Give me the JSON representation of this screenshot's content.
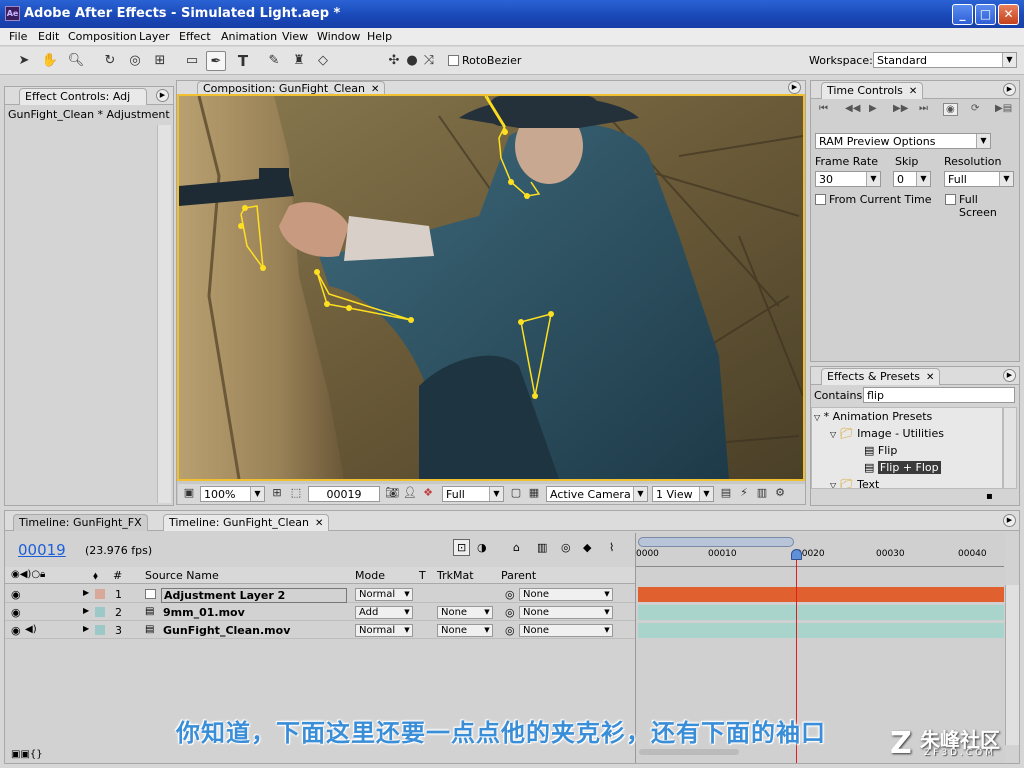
{
  "window": {
    "title": "Adobe After Effects - Simulated Light.aep *",
    "app_icon": "Ae"
  },
  "menu": [
    "File",
    "Edit",
    "Composition",
    "Layer",
    "Effect",
    "Animation",
    "View",
    "Window",
    "Help"
  ],
  "toolbar": {
    "rotobezier_label": "RotoBezier",
    "workspace_label": "Workspace:",
    "workspace_value": "Standard"
  },
  "effect_controls": {
    "tab_label": "Effect Controls: Adj",
    "layer_label": "GunFight_Clean * Adjustment Lay"
  },
  "composition": {
    "tab_label": "Composition: GunFight_Clean",
    "zoom": "100%",
    "timecode": "00019",
    "resolution": "Full",
    "camera": "Active Camera",
    "view": "1 View"
  },
  "time_controls": {
    "tab_label": "Time Controls",
    "ram_preview": "RAM Preview Options",
    "frame_rate_label": "Frame Rate",
    "frame_rate": "30",
    "skip_label": "Skip",
    "skip": "0",
    "resolution_label": "Resolution",
    "resolution": "Full",
    "from_current": "From Current Time",
    "full_screen": "Full Screen"
  },
  "effects_presets": {
    "tab_label": "Effects & Presets",
    "contains_label": "Contains:",
    "contains_value": "flip",
    "tree": [
      "* Animation Presets",
      "Image - Utilities",
      "Flip",
      "Flip + Flop",
      "Text"
    ]
  },
  "timeline": {
    "tabs": [
      "Timeline: GunFight_FX",
      "Timeline: GunFight_Clean"
    ],
    "timecode": "00019",
    "fps": "(23.976 fps)",
    "headers": {
      "num": "#",
      "source": "Source Name",
      "mode": "Mode",
      "t": "T",
      "trkmat": "TrkMat",
      "parent": "Parent"
    },
    "ruler": [
      "0000",
      "00010",
      "00020",
      "00030",
      "00040"
    ],
    "layers": [
      {
        "num": "1",
        "name": "Adjustment Layer 2",
        "mode": "Normal",
        "trkmat": "",
        "parent": "None",
        "color": "#d8a898"
      },
      {
        "num": "2",
        "name": "9mm_01.mov",
        "mode": "Add",
        "trkmat": "None",
        "parent": "None",
        "color": "#9cc8c8"
      },
      {
        "num": "3",
        "name": "GunFight_Clean.mov",
        "mode": "Normal",
        "trkmat": "None",
        "parent": "None",
        "color": "#9cc8c8"
      }
    ]
  },
  "subtitle": "你知道，下面这里还要一点点他的夹克衫，还有下面的袖口",
  "watermark": {
    "brand": "朱峰社区",
    "url": "ZF3D.COM"
  },
  "colors": {
    "title_bar": "#1a49b8",
    "accent": "#f0c030",
    "adjustment_bar": "#e06030",
    "footage_bar": "#a8d4cc",
    "playhead": "#e02020",
    "timecode_blue": "#1e5ed8"
  }
}
